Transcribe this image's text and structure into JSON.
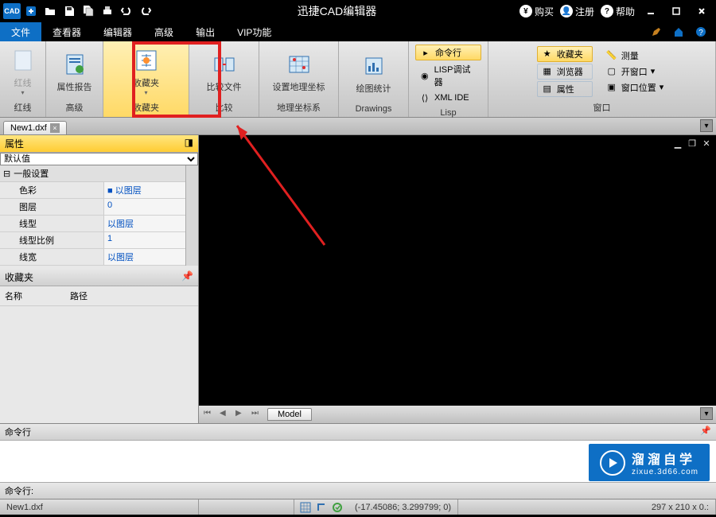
{
  "titlebar": {
    "app_icon": "CAD",
    "title": "迅捷CAD编辑器",
    "buy": "购买",
    "register": "注册",
    "help": "帮助"
  },
  "menubar": {
    "items": [
      "文件",
      "查看器",
      "编辑器",
      "高级",
      "输出",
      "VIP功能"
    ]
  },
  "ribbon": {
    "groups": [
      {
        "label": "红线",
        "big": {
          "label": "红线",
          "disabled": true
        }
      },
      {
        "label": "高级",
        "big": {
          "label": "属性报告"
        }
      },
      {
        "label": "收藏夹",
        "big": {
          "label": "收藏夹",
          "highlight": true
        }
      },
      {
        "label": "比较",
        "big": {
          "label": "比较文件"
        }
      },
      {
        "label": "地理坐标系",
        "big": {
          "label": "设置地理坐标"
        }
      },
      {
        "label": "Drawings",
        "big": {
          "label": "绘图统计"
        }
      },
      {
        "label": "Lisp",
        "small": [
          "命令行",
          "LISP调试器",
          "XML IDE"
        ]
      },
      {
        "label": "窗口",
        "cols": [
          [
            "收藏夹",
            "浏览器",
            "属性"
          ],
          [
            "测量",
            "开窗口",
            "窗口位置"
          ]
        ]
      }
    ]
  },
  "file_tab": "New1.dxf",
  "properties": {
    "title": "属性",
    "combo": "默认值",
    "group_hdr": "一般设置",
    "rows": [
      {
        "k": "色彩",
        "v": "■ 以图层"
      },
      {
        "k": "图层",
        "v": "0"
      },
      {
        "k": "线型",
        "v": "以图层"
      },
      {
        "k": "线型比例",
        "v": "1"
      },
      {
        "k": "线宽",
        "v": "以图层"
      }
    ]
  },
  "favorites": {
    "title": "收藏夹",
    "col_name": "名称",
    "col_path": "路径"
  },
  "model_tab": "Model",
  "cmd": {
    "title": "命令行",
    "label": "命令行:"
  },
  "watermark": {
    "brand": "溜溜自学",
    "url": "zixue.3d66.com"
  },
  "statusbar": {
    "file": "New1.dxf",
    "coords": "(-17.45086; 3.299799; 0)",
    "paper": "297 x 210 x 0.:"
  }
}
